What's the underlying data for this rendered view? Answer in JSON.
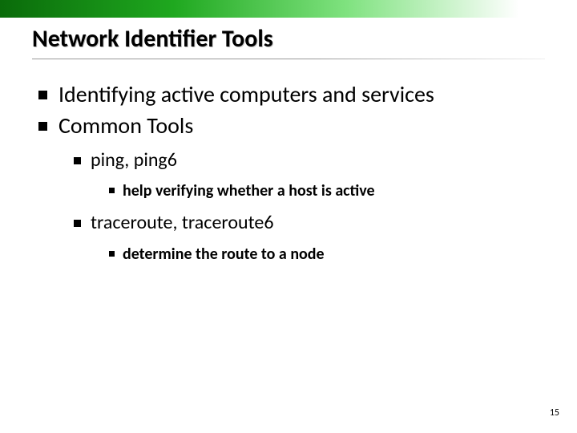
{
  "slide": {
    "title": "Network Identifier Tools",
    "page_number": "15"
  },
  "bullets": {
    "l1_a": "Identifying active computers and services",
    "l1_b": "Common Tools",
    "l2_a": "ping, ping6",
    "l3_a": "help verifying whether a host is active",
    "l2_b": "traceroute, traceroute6",
    "l3_b": "determine the route to a node"
  }
}
